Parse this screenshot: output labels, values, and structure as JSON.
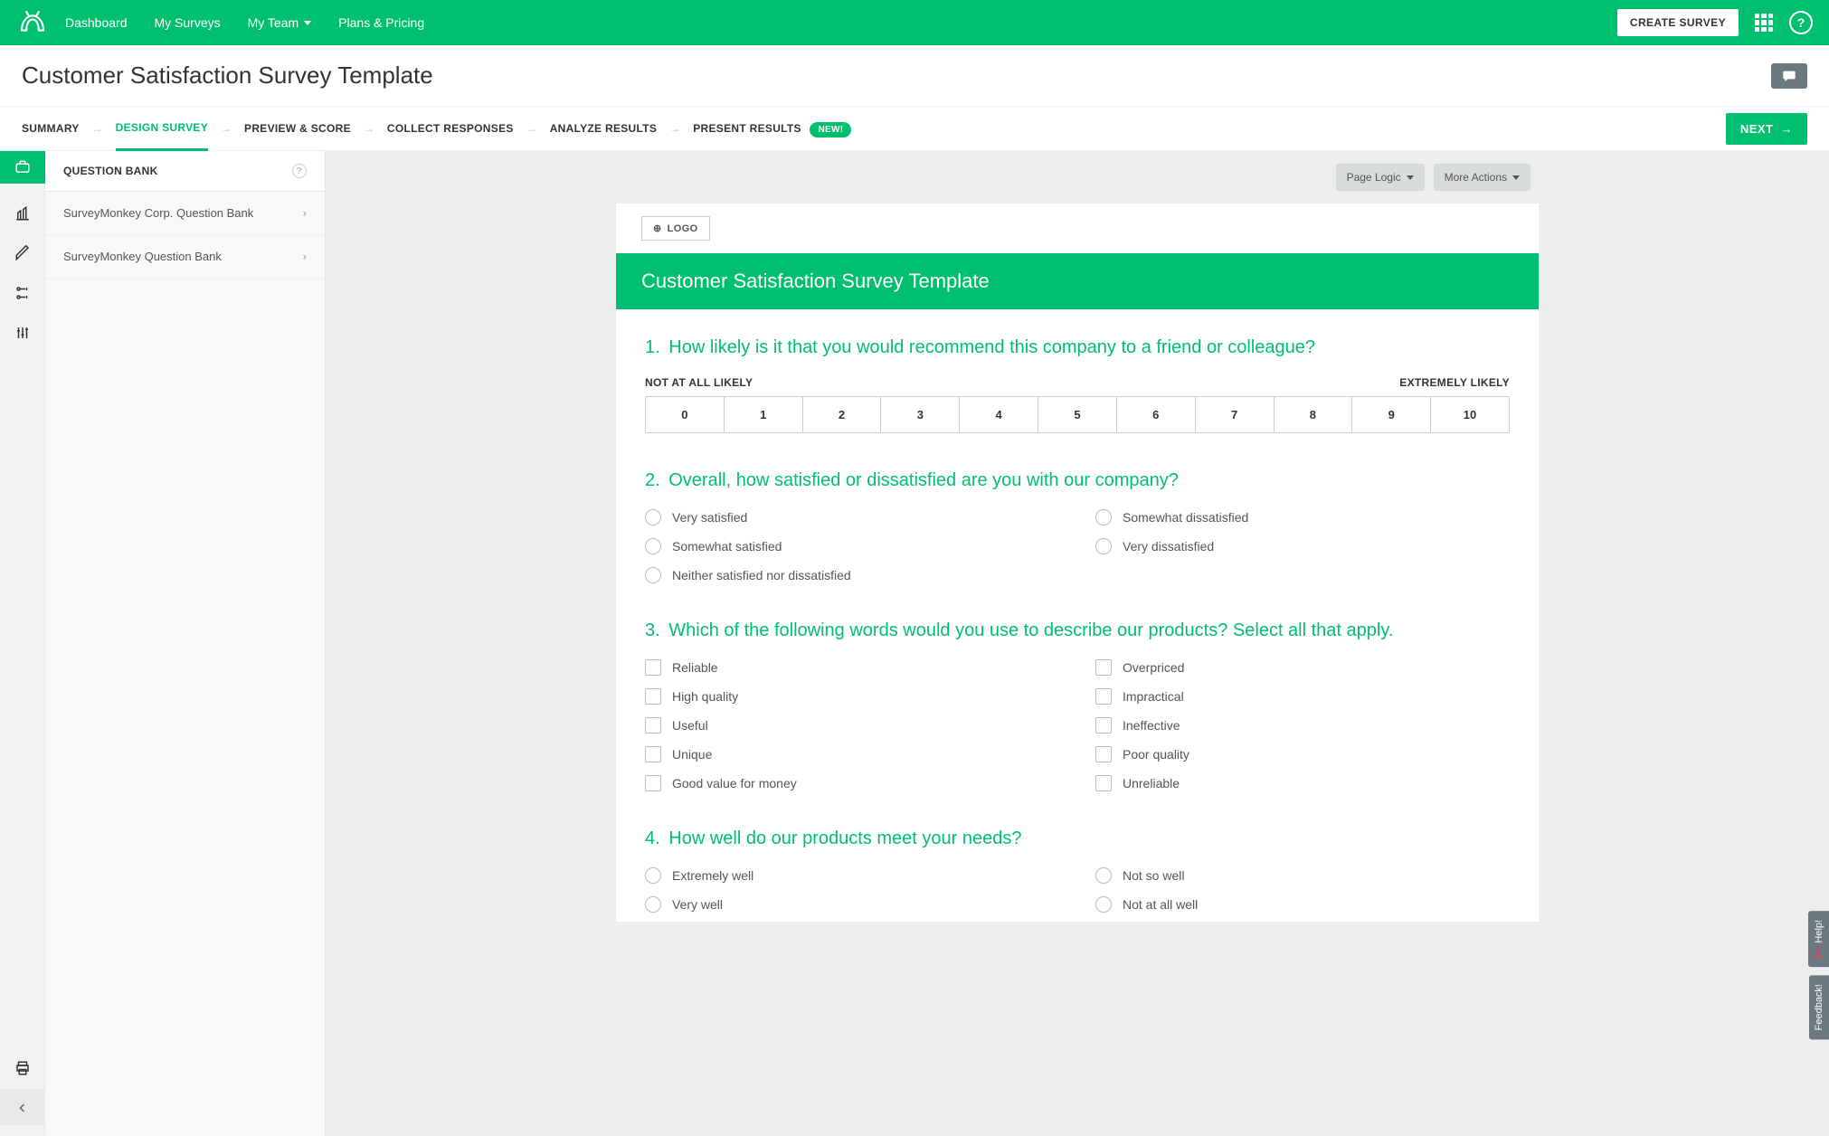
{
  "nav": {
    "dashboard": "Dashboard",
    "mySurveys": "My Surveys",
    "myTeam": "My Team",
    "plansPricing": "Plans & Pricing",
    "createSurvey": "CREATE SURVEY"
  },
  "page": {
    "title": "Customer Satisfaction Survey Template"
  },
  "steps": {
    "summary": "SUMMARY",
    "design": "DESIGN SURVEY",
    "preview": "PREVIEW & SCORE",
    "collect": "COLLECT RESPONSES",
    "analyze": "ANALYZE RESULTS",
    "present": "PRESENT RESULTS",
    "newBadge": "NEW!",
    "next": "NEXT"
  },
  "sidebar": {
    "header": "QUESTION BANK",
    "items": [
      "SurveyMonkey Corp. Question Bank",
      "SurveyMonkey Question Bank"
    ]
  },
  "pageActions": {
    "logic": "Page Logic",
    "more": "More Actions"
  },
  "survey": {
    "logoBtn": "LOGO",
    "title": "Customer Satisfaction Survey Template"
  },
  "q1": {
    "num": "1.",
    "text": "How likely is it that you would recommend this company to a friend or colleague?",
    "labelLow": "NOT AT ALL LIKELY",
    "labelHigh": "EXTREMELY LIKELY",
    "scale": [
      "0",
      "1",
      "2",
      "3",
      "4",
      "5",
      "6",
      "7",
      "8",
      "9",
      "10"
    ]
  },
  "q2": {
    "num": "2.",
    "text": "Overall, how satisfied or dissatisfied are you with our company?",
    "options": [
      "Very satisfied",
      "Somewhat satisfied",
      "Neither satisfied nor dissatisfied",
      "Somewhat dissatisfied",
      "Very dissatisfied"
    ]
  },
  "q3": {
    "num": "3.",
    "text": "Which of the following words would you use to describe our products? Select all that apply.",
    "options": [
      "Reliable",
      "High quality",
      "Useful",
      "Unique",
      "Good value for money",
      "Overpriced",
      "Impractical",
      "Ineffective",
      "Poor quality",
      "Unreliable"
    ]
  },
  "q4": {
    "num": "4.",
    "text": "How well do our products meet your needs?",
    "options": [
      "Extremely well",
      "Very well",
      "Not so well",
      "Not at all well"
    ]
  },
  "feedback": {
    "help": "❓ Help!",
    "fb": "Feedback!"
  }
}
